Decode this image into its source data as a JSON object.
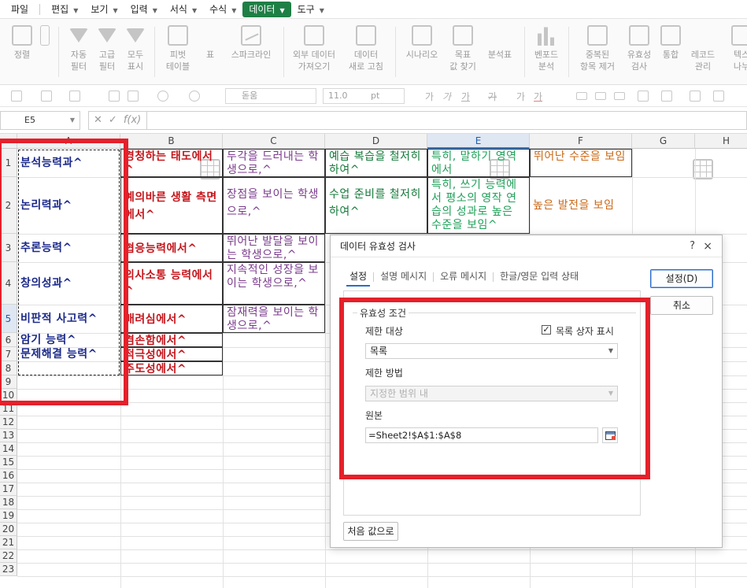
{
  "menu": {
    "items": [
      {
        "label": "파일",
        "caret": false
      },
      {
        "label": "편집",
        "caret": true
      },
      {
        "label": "보기",
        "caret": true
      },
      {
        "label": "입력",
        "caret": true
      },
      {
        "label": "서식",
        "caret": true
      },
      {
        "label": "수식",
        "caret": true
      },
      {
        "label": "데이터",
        "caret": true,
        "active": true
      },
      {
        "label": "도구",
        "caret": true
      }
    ]
  },
  "ribbon": {
    "sort": "정렬",
    "auto_filter": [
      "자동",
      "필터"
    ],
    "adv_filter": [
      "고급",
      "필터"
    ],
    "show_all": [
      "모두",
      "표시"
    ],
    "pivot": [
      "피벗",
      "테이블"
    ],
    "table": "표",
    "sparkline": "스파크라인",
    "external": [
      "외부 데이터",
      "가져오기"
    ],
    "refresh": [
      "데이터",
      "새로 고침"
    ],
    "scenario": "시나리오",
    "goal_seek": [
      "목표",
      "값 찾기"
    ],
    "analysis": "분석표",
    "benford": [
      "벤포드",
      "분석"
    ],
    "dup_remove": [
      "중복된",
      "항목 제거"
    ],
    "validation": [
      "유효성",
      "검사"
    ],
    "consolidate": "통합",
    "record": [
      "레코드",
      "관리"
    ],
    "text_split": [
      "텍스",
      "나누"
    ]
  },
  "format_toolbar": {
    "font": "돋움",
    "size": "11.0",
    "unit": "pt"
  },
  "formula": {
    "cell_ref": "E5",
    "fx": "f(x)"
  },
  "columns": [
    "A",
    "B",
    "C",
    "D",
    "E",
    "F",
    "G",
    "H"
  ],
  "rows": [
    "1",
    "2",
    "3",
    "4",
    "5",
    "6",
    "7",
    "8",
    "9",
    "10",
    "11",
    "12",
    "13",
    "14",
    "15",
    "16",
    "17",
    "18",
    "19",
    "20",
    "21",
    "22",
    "23"
  ],
  "cells": {
    "A1": "분석능력과^",
    "A2": "논리력과^",
    "A3": "추론능력^",
    "A4": "창의성과^",
    "A5": "비판적 사고력^",
    "A6": "암기 능력^",
    "A7": "문제해결 능력^",
    "B1": "경청하는 태도에서^",
    "B2": "예의바른 생활 측면에서^",
    "B3": "협응능력에서^",
    "B4": "의사소통 능력에서^",
    "B5": "배려심에서^",
    "B6": "겸손함에서^",
    "B7": "적극성에서^",
    "B8": "주도성에서^",
    "C1": "두각을 드러내는 학생으로,^",
    "C2": "장점을 보이는 학생으로,^",
    "C3": "뛰어난 발달을 보이는 학생으로,^",
    "C4": "지속적인 성장을 보이는 학생으로,^",
    "C5": "잠재력을 보이는 학생으로,^",
    "D1": "예습 복습을 철저히 하여^",
    "D2": "수업 준비를 철저히 하여^",
    "E1": "특히, 말하기 영역에서",
    "E2": "특히, 쓰기 능력에서 평소의 영작 연습의 성과로 높은 수준을 보임^",
    "F1": "뛰어난 수준을 보임",
    "F2": "높은 발전을 보임"
  },
  "dialog": {
    "title": "데이터 유효성 검사",
    "help": "?",
    "close": "×",
    "tabs": [
      "설정",
      "설명 메시지",
      "오류 메시지",
      "한글/영문 입력 상태"
    ],
    "group_label": "유효성 조건",
    "allow_label": "제한 대상",
    "allow_value": "목록",
    "in_cell_dropdown": "목록 상자 표시",
    "in_cell_dropdown_checked": true,
    "data_label": "제한 방법",
    "data_value": "지정한 범위 내",
    "source_label": "원본",
    "source_value": "=Sheet2!$A$1:$A$8",
    "ok": "설정(D)",
    "cancel": "취소",
    "clear_all": "처음 값으로"
  }
}
